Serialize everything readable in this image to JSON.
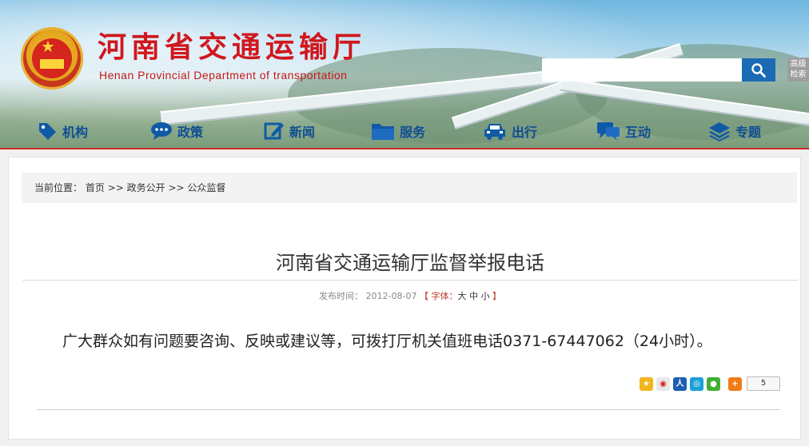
{
  "header": {
    "title": "河南省交通运输厅",
    "subtitle": "Henan Provincial Department of transportation",
    "search": {
      "value": "",
      "placeholder": "",
      "button_icon": "search-icon",
      "advanced_label": "高级检索"
    }
  },
  "nav": {
    "items": [
      {
        "label": "机构",
        "icon": "tag-icon"
      },
      {
        "label": "政策",
        "icon": "chat-bubble-icon"
      },
      {
        "label": "新闻",
        "icon": "edit-icon"
      },
      {
        "label": "服务",
        "icon": "folder-icon"
      },
      {
        "label": "出行",
        "icon": "car-icon"
      },
      {
        "label": "互动",
        "icon": "chat-bubbles-icon"
      },
      {
        "label": "专题",
        "icon": "layers-icon"
      }
    ]
  },
  "breadcrumb": {
    "prefix": "当前位置：",
    "items": [
      "首页",
      "政务公开",
      "公众监督"
    ],
    "separator": ">>"
  },
  "article": {
    "title": "河南省交通运输厅监督举报电话",
    "date_label": "发布时间：",
    "date": "2012-08-07",
    "font_size_label": "【 字体：",
    "font_large": "大",
    "font_medium": "中",
    "font_small": "小",
    "font_close": "】",
    "body": "广大群众如有问题要咨询、反映或建议等，可拨打厅机关值班电话0371-67447062（24小时）。"
  },
  "share": {
    "icons": [
      "qzone-icon",
      "weibo-icon",
      "renren-icon",
      "tencent-weibo-icon",
      "wechat-icon",
      "more-share-icon"
    ],
    "count": "5"
  },
  "colors": {
    "brand_red": "#d0171e",
    "nav_blue": "#0f4e94",
    "search_blue": "#1a6bb4"
  }
}
